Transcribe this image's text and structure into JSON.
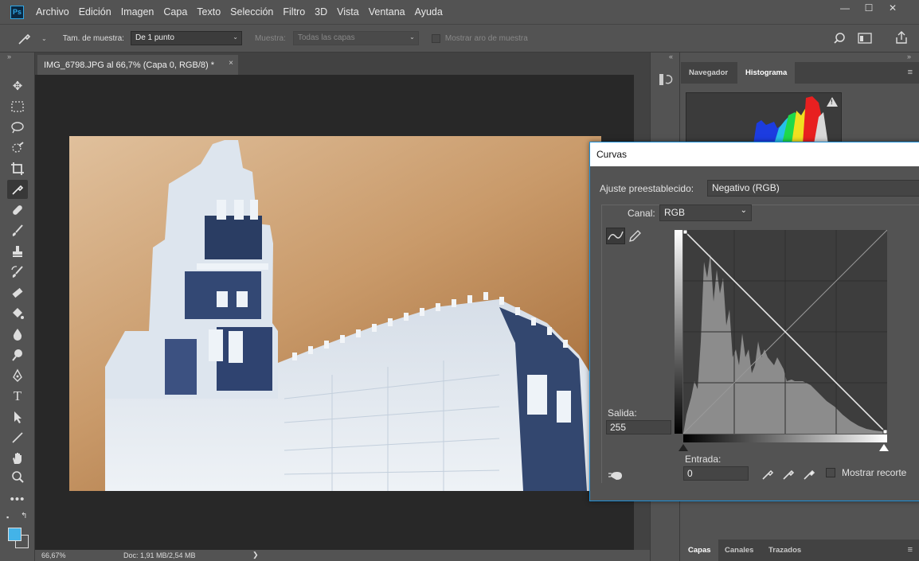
{
  "app": {
    "menu": [
      "Archivo",
      "Edición",
      "Imagen",
      "Capa",
      "Texto",
      "Selección",
      "Filtro",
      "3D",
      "Vista",
      "Ventana",
      "Ayuda"
    ],
    "window_controls": [
      "—",
      "☐",
      "✕"
    ],
    "logo": "Ps"
  },
  "options_bar": {
    "sample_size_label": "Tam. de muestra:",
    "sample_size_value": "De 1 punto",
    "sample_label": "Muestra:",
    "sample_value": "Todas las capas",
    "show_ring_label": "Mostrar aro de muestra"
  },
  "document": {
    "tab_title": "IMG_6798.JPG al 66,7% (Capa 0, RGB/8) *",
    "close_glyph": "×",
    "zoom": "66,67%",
    "doc_info": "Doc: 1,91 MB/2,54 MB",
    "status_arrow": "❯"
  },
  "panels": {
    "top_tabs": [
      "Navegador",
      "Histograma"
    ],
    "active_top_tab": "Histograma",
    "bottom_tabs": [
      "Capas",
      "Canales",
      "Trazados"
    ],
    "active_bottom_tab": "Capas",
    "warning_glyph": "!"
  },
  "curves": {
    "title": "Curvas",
    "preset_label": "Ajuste preestablecido:",
    "preset_value": "Negativo (RGB)",
    "channel_label": "Canal:",
    "channel_value": "RGB",
    "output_label": "Salida:",
    "output_value": "255",
    "input_label": "Entrada:",
    "input_value": "0",
    "show_clipping_label": "Mostrar recorte"
  },
  "colors": {
    "accent": "#1e90d8",
    "foreground_swatch": "#43b3e8",
    "sky": "#c99a6a"
  }
}
